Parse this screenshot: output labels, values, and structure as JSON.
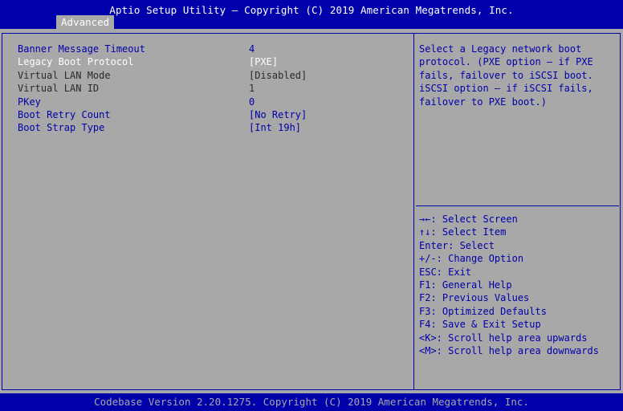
{
  "header": {
    "title": "Aptio Setup Utility – Copyright (C) 2019 American Megatrends, Inc.",
    "tab": "Advanced"
  },
  "settings": [
    {
      "label": "Banner Message Timeout",
      "value": "4",
      "style": "blue"
    },
    {
      "label": "Legacy Boot Protocol",
      "value": "[PXE]",
      "style": "white"
    },
    {
      "label": "Virtual LAN Mode",
      "value": "[Disabled]",
      "style": "dark"
    },
    {
      "label": "Virtual LAN ID",
      "value": "1",
      "style": "dark"
    },
    {
      "label": "PKey",
      "value": "0",
      "style": "blue"
    },
    {
      "label": "Boot Retry Count",
      "value": "[No Retry]",
      "style": "blue"
    },
    {
      "label": "Boot Strap Type",
      "value": "[Int 19h]",
      "style": "blue"
    }
  ],
  "help": {
    "text": "Select a Legacy network boot\nprotocol. (PXE option – if PXE\nfails, failover to iSCSI boot.\niSCSI option – if iSCSI fails,\nfailover to PXE boot.)",
    "keys": [
      "→←: Select Screen",
      "↑↓: Select Item",
      "Enter: Select",
      "+/-: Change Option",
      "ESC: Exit",
      "F1: General Help",
      "F2: Previous Values",
      "F3: Optimized Defaults",
      "F4: Save & Exit Setup",
      "<K>: Scroll help area upwards",
      "<M>: Scroll help area downwards"
    ]
  },
  "footer": {
    "text": "Codebase Version 2.20.1275. Copyright (C) 2019 American Megatrends, Inc."
  },
  "colors": {
    "background": "#a8a8a8",
    "accent": "#0000aa",
    "highlight": "#ffffff"
  }
}
